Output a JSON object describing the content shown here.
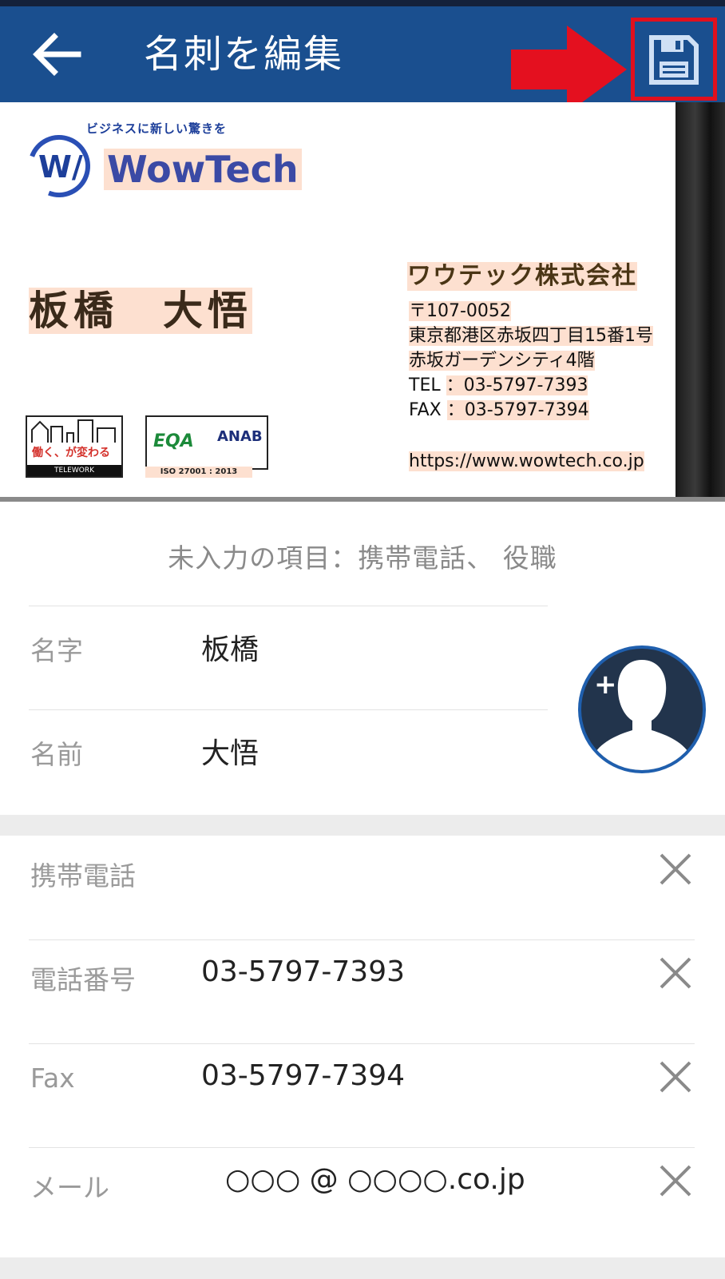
{
  "appbar": {
    "title": "名刺を編集",
    "back_icon": "arrow-left-icon",
    "save_icon": "floppy-save-icon",
    "accent_color": "#1a4f8f",
    "highlight_color": "#e0101e"
  },
  "card": {
    "tagline": "ビジネスに新しい驚きを",
    "brand": "WowTech",
    "person_name": "板橋　大悟",
    "company": "ワウテック株式会社",
    "postal": "〒107-0052",
    "address1": "東京都港区赤坂四丁目15番1号",
    "address2": "赤坂ガーデンシティ4階",
    "tel_label": "TEL",
    "tel": "：03-5797-7393",
    "fax_label": "FAX",
    "fax": "：03-5797-7394",
    "url": "https://www.wowtech.co.jp",
    "badge1": "働く、が変わる",
    "badge1_sub": "TELEWORK",
    "badge2_left": "EQA",
    "badge2_right": "ANAB",
    "badge2_sub": "ISO 27001 : 2013"
  },
  "form": {
    "missing_notice": "未入力の項目：携帯電話、 役職",
    "last_name_label": "名字",
    "last_name_value": "板橋",
    "first_name_label": "名前",
    "first_name_value": "大悟",
    "avatar_plus": "+",
    "rows": [
      {
        "label": "携帯電話",
        "value": ""
      },
      {
        "label": "電話番号",
        "value": "03-5797-7393"
      },
      {
        "label": "Fax",
        "value": "03-5797-7394"
      },
      {
        "label": "メール",
        "value": "○○○ @ ○○○○.co.jp"
      }
    ]
  }
}
